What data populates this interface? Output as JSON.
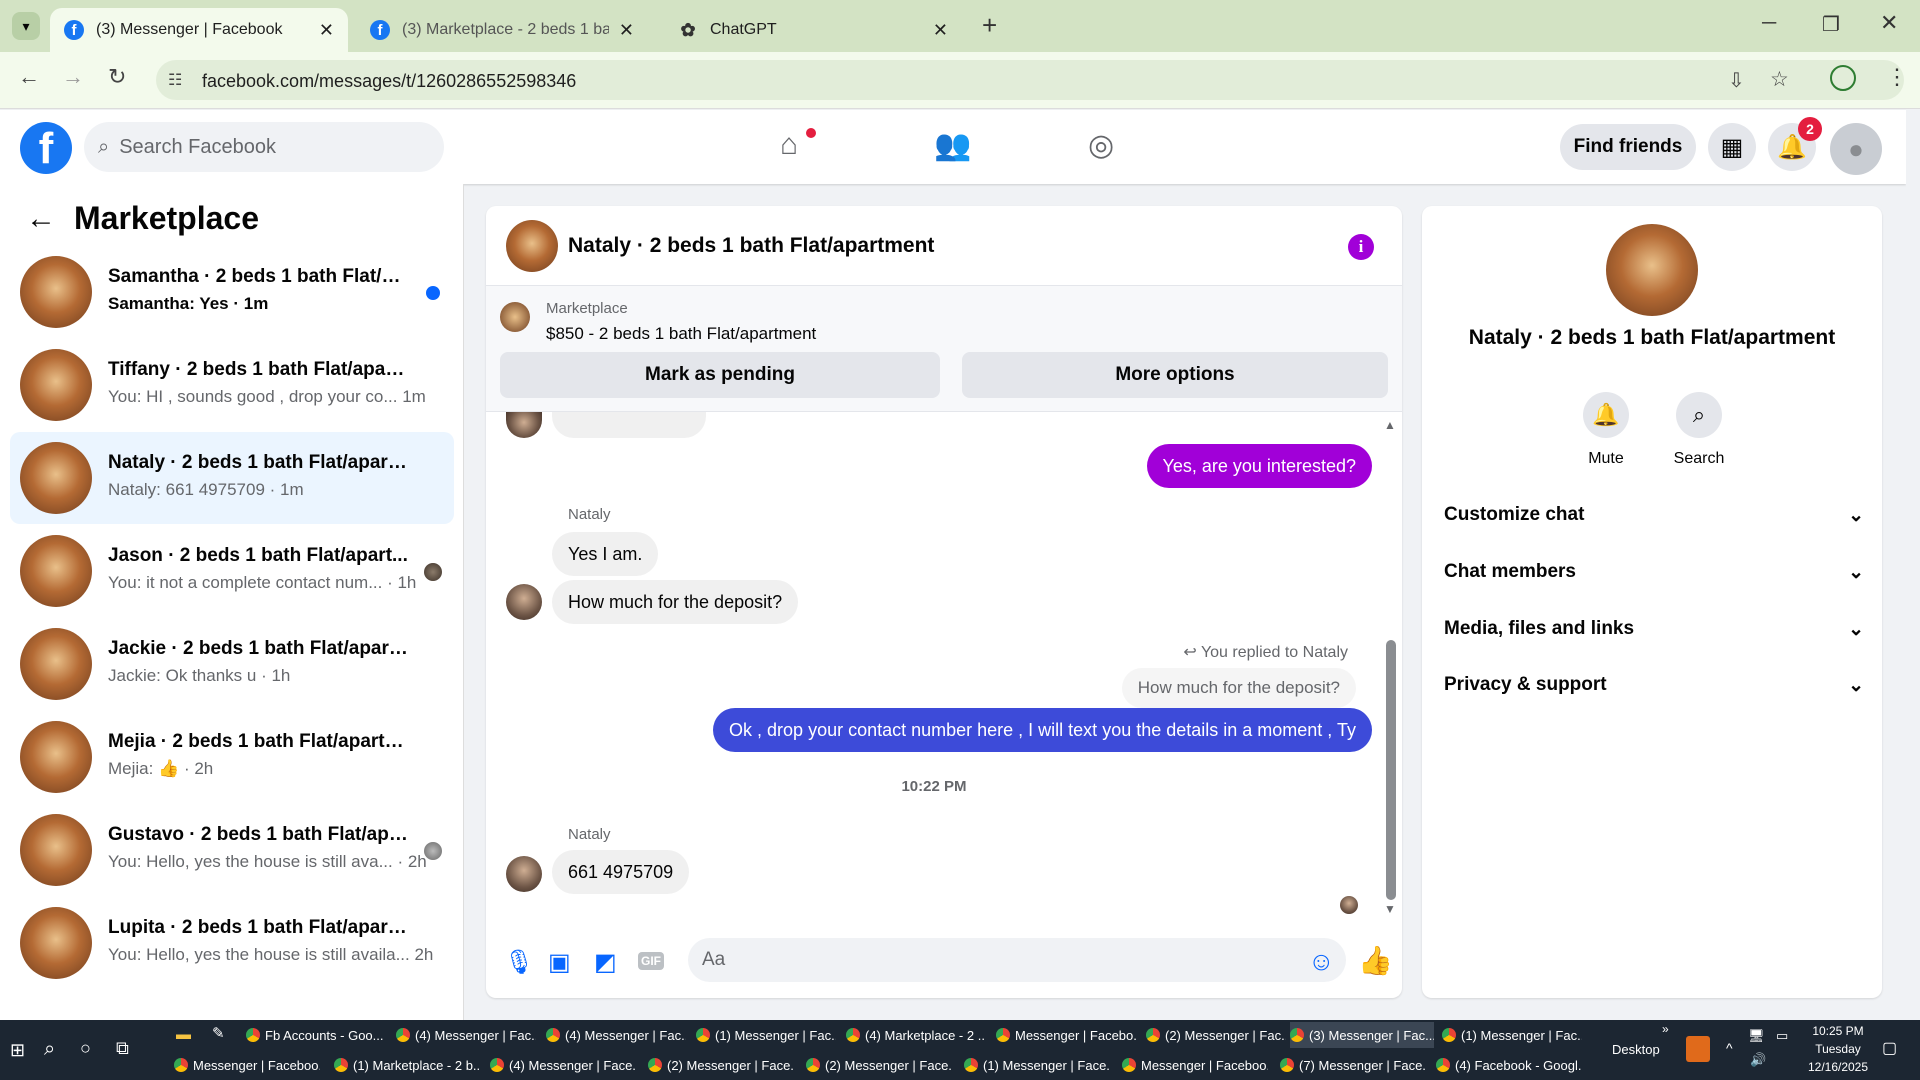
{
  "browser": {
    "tabs": [
      {
        "label": "(3) Messenger | Facebook",
        "active": true
      },
      {
        "label": "(3) Marketplace - 2 beds 1 bath",
        "active": false
      },
      {
        "label": "ChatGPT",
        "active": false
      }
    ],
    "url": "facebook.com/messages/t/1260286552598346"
  },
  "fb": {
    "search_placeholder": "Search Facebook",
    "find_friends": "Find friends",
    "notif_count": "2"
  },
  "left": {
    "title": "Marketplace",
    "conversations": [
      {
        "name": "Samantha · 2 beds 1 bath Flat/ap...",
        "preview": "Samantha: Yes · 1m",
        "unread": true
      },
      {
        "name": "Tiffany · 2 beds 1 bath Flat/apartm...",
        "preview": "You: HI , sounds good , drop your co...  1m"
      },
      {
        "name": "Nataly · 2 beds 1 bath Flat/apartm...",
        "preview": "Nataly: 661 4975709 · 1m",
        "active": true
      },
      {
        "name": "Jason · 2 beds 1 bath Flat/apart...",
        "preview": "You: it not a complete contact num... · 1h"
      },
      {
        "name": "Jackie · 2 beds 1 bath Flat/apartme...",
        "preview": "Jackie: Ok thanks u · 1h"
      },
      {
        "name": "Mejia · 2 beds 1 bath Flat/apartment",
        "preview": "Mejia: 👍 · 2h"
      },
      {
        "name": "Gustavo · 2 beds 1 bath Flat/apa...",
        "preview": "You: Hello, yes the house is still ava... · 2h"
      },
      {
        "name": "Lupita · 2 beds 1 bath Flat/apartm...",
        "preview": "You: Hello, yes the house is still availa...  2h"
      }
    ]
  },
  "chat": {
    "title": "Nataly · 2 beds 1 bath Flat/apartment",
    "marketplace_label": "Marketplace",
    "listing": "$850 - 2 beds 1 bath Flat/apartment",
    "mark_pending": "Mark as pending",
    "more_options": "More options",
    "messages": {
      "out1": "Yes, are you interested?",
      "sender1": "Nataly",
      "in1": "Yes I am.",
      "in2": "How much for the deposit?",
      "replied_to": "You replied to Nataly",
      "quoted": "How much for the deposit?",
      "out2": "Ok , drop your contact number here , I will text you the details in a moment , Ty",
      "time": "10:22 PM",
      "sender2": "Nataly",
      "in3": "661 4975709"
    },
    "input_placeholder": "Aa",
    "gif": "GIF"
  },
  "right": {
    "name": "Nataly · 2 beds 1 bath Flat/apartment",
    "mute": "Mute",
    "search": "Search",
    "sections": [
      "Customize chat",
      "Chat members",
      "Media, files and links",
      "Privacy & support"
    ]
  },
  "taskbar": {
    "row1": [
      "Fb Accounts - Goo...",
      "(4) Messenger | Fac...",
      "(4) Messenger | Fac...",
      "(1) Messenger | Fac...",
      "(4) Marketplace - 2 ...",
      "Messenger | Facebo...",
      "(2) Messenger | Fac...",
      "(3) Messenger | Fac...",
      "(1) Messenger | Fac..."
    ],
    "row2": [
      "Messenger | Faceboo...",
      "(1) Marketplace - 2 b...",
      "(4) Messenger | Face...",
      "(2) Messenger | Face...",
      "(2) Messenger | Face...",
      "(1) Messenger | Face...",
      "Messenger | Faceboo...",
      "(7) Messenger | Face...",
      "(4) Facebook - Googl..."
    ],
    "desktop": "Desktop",
    "time": "10:25 PM",
    "day": "Tuesday",
    "date": "12/16/2025"
  }
}
